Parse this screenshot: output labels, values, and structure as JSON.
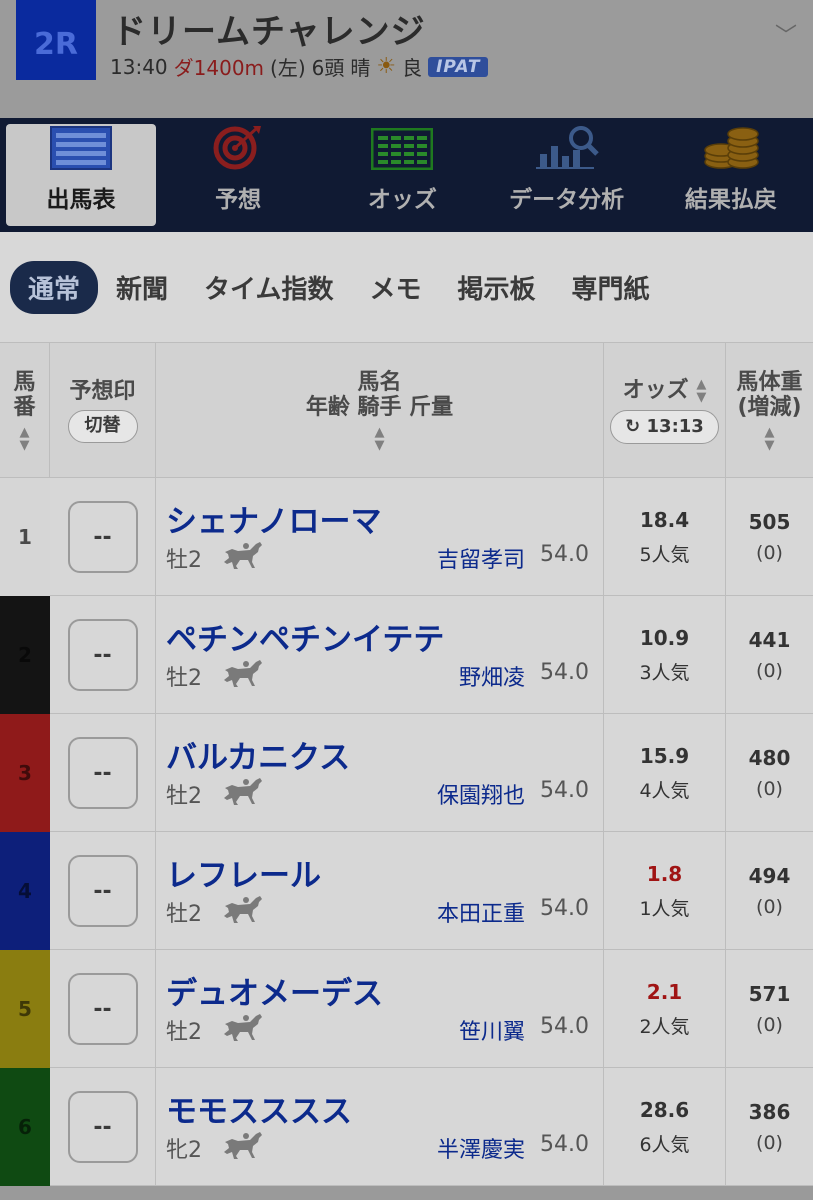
{
  "race": {
    "number": "2R",
    "name": "ドリームチャレンジ",
    "time": "13:40",
    "course": "ダ1400m",
    "direction": "(左)",
    "runners": "6頭",
    "weather": "晴",
    "going": "良",
    "ipat": "IPAT"
  },
  "main_nav": [
    {
      "label": "出馬表",
      "icon": "race-card-icon",
      "active": true
    },
    {
      "label": "予想",
      "icon": "target-icon",
      "active": false
    },
    {
      "label": "オッズ",
      "icon": "odds-grid-icon",
      "active": false
    },
    {
      "label": "データ分析",
      "icon": "chart-search-icon",
      "active": false
    },
    {
      "label": "結果払戻",
      "icon": "coins-icon",
      "active": false
    }
  ],
  "sub_nav": [
    {
      "label": "通常",
      "active": true
    },
    {
      "label": "新聞",
      "active": false
    },
    {
      "label": "タイム指数",
      "active": false
    },
    {
      "label": "メモ",
      "active": false
    },
    {
      "label": "掲示板",
      "active": false
    },
    {
      "label": "専門紙",
      "active": false
    }
  ],
  "table_header": {
    "no_line1": "馬",
    "no_line2": "番",
    "mark": "予想印",
    "mark_toggle": "切替",
    "name_line1": "馬名",
    "name_line2": "年齢 騎手 斤量",
    "odds": "オッズ",
    "odds_time": "13:13",
    "bw_line1": "馬体重",
    "bw_line2": "(増減)"
  },
  "colors": {
    "gate1": "#d6d6d6",
    "gate2": "#141414",
    "gate3": "#8f1a1a",
    "gate4": "#0d1f7a",
    "gate5": "#8a7d10",
    "gate6": "#0f4a12"
  },
  "horses": [
    {
      "no": "1",
      "mark": "--",
      "name": "シェナノローマ",
      "sexage": "牡2",
      "jockey": "吉留孝司",
      "weight": "54.0",
      "odds": "18.4",
      "pop": "5人気",
      "bw": "505",
      "bwd": "(0)",
      "fav": false
    },
    {
      "no": "2",
      "mark": "--",
      "name": "ペチンペチンイテテ",
      "sexage": "牡2",
      "jockey": "野畑凌",
      "weight": "54.0",
      "odds": "10.9",
      "pop": "3人気",
      "bw": "441",
      "bwd": "(0)",
      "fav": false
    },
    {
      "no": "3",
      "mark": "--",
      "name": "バルカニクス",
      "sexage": "牡2",
      "jockey": "保園翔也",
      "weight": "54.0",
      "odds": "15.9",
      "pop": "4人気",
      "bw": "480",
      "bwd": "(0)",
      "fav": false
    },
    {
      "no": "4",
      "mark": "--",
      "name": "レフレール",
      "sexage": "牡2",
      "jockey": "本田正重",
      "weight": "54.0",
      "odds": "1.8",
      "pop": "1人気",
      "bw": "494",
      "bwd": "(0)",
      "fav": true
    },
    {
      "no": "5",
      "mark": "--",
      "name": "デュオメーデス",
      "sexage": "牡2",
      "jockey": "笹川翼",
      "weight": "54.0",
      "odds": "2.1",
      "pop": "2人気",
      "bw": "571",
      "bwd": "(0)",
      "fav": true
    },
    {
      "no": "6",
      "mark": "--",
      "name": "モモスススス",
      "sexage": "牝2",
      "jockey": "半澤慶実",
      "weight": "54.0",
      "odds": "28.6",
      "pop": "6人気",
      "bw": "386",
      "bwd": "(0)",
      "fav": false
    }
  ]
}
